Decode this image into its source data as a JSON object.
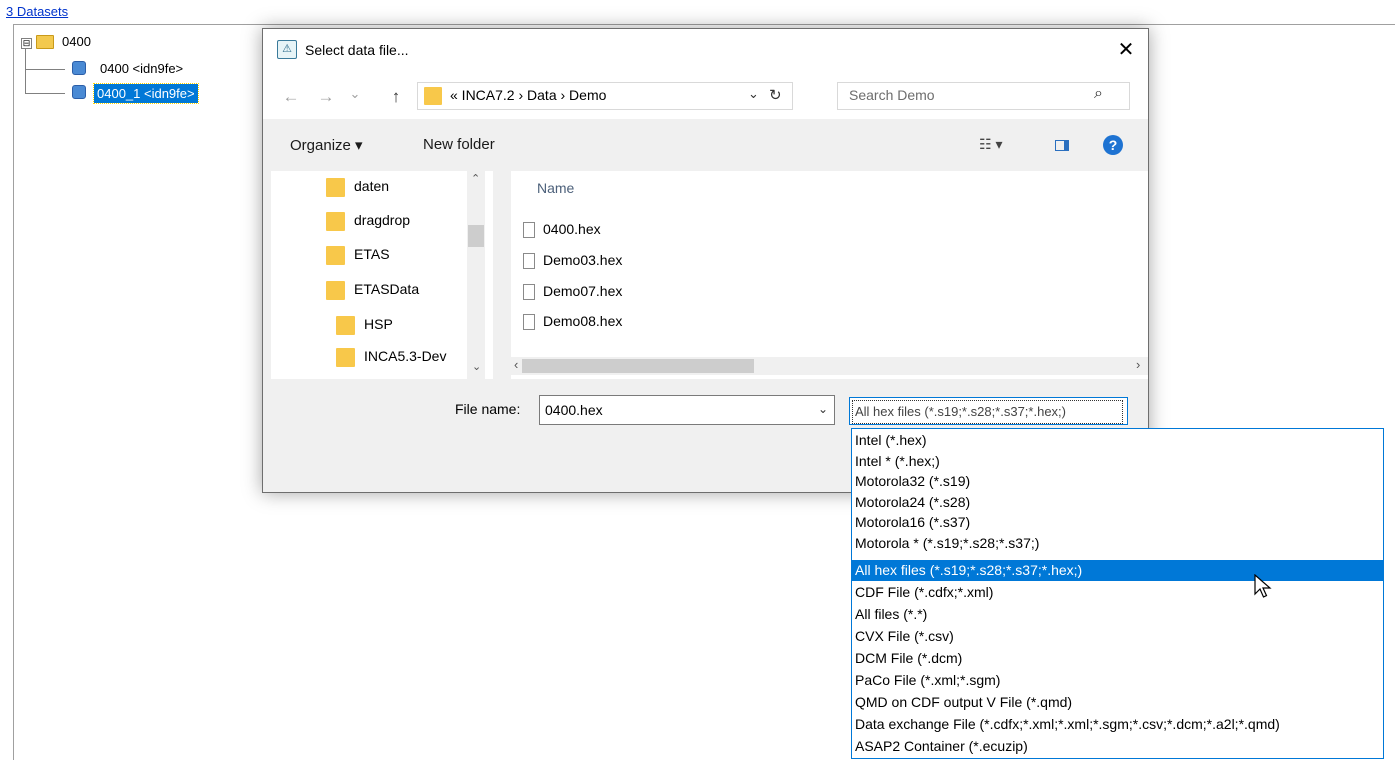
{
  "background": {
    "datasets_link": "3 Datasets",
    "tree": {
      "root": {
        "label": "0400"
      },
      "items": [
        {
          "label": "0400 <idn9fe>",
          "selected": false
        },
        {
          "label": "0400_1 <idn9fe>",
          "selected": true
        }
      ],
      "expander": "⊟"
    }
  },
  "dialog": {
    "title": "Select data file...",
    "close_glyph": "✕",
    "nav": {
      "back": "←",
      "forward": "→",
      "recent": "⌄",
      "up": "↑"
    },
    "address": {
      "path": "«  INCA7.2  ›  Data  ›  Demo"
    },
    "search": {
      "placeholder": "Search Demo"
    },
    "toolbar": {
      "organize_label": "Organize ▾",
      "new_folder_label": "New folder"
    },
    "nav_pane": {
      "items": [
        {
          "label": "daten"
        },
        {
          "label": "dragdrop"
        },
        {
          "label": "ETAS"
        },
        {
          "label": "ETASData"
        },
        {
          "label": "HSP"
        },
        {
          "label": "INCA5.3-Dev"
        }
      ]
    },
    "file_list": {
      "column_name": "Name",
      "files": [
        {
          "name": "0400.hex"
        },
        {
          "name": "Demo03.hex"
        },
        {
          "name": "Demo07.hex"
        },
        {
          "name": "Demo08.hex"
        }
      ]
    },
    "file_name": {
      "label": "File name:",
      "value": "0400.hex"
    },
    "file_type": {
      "value": "All hex files (*.s19;*.s28;*.s37;*.hex;)"
    }
  },
  "dropdown": {
    "options": [
      {
        "label": "Intel (*.hex)"
      },
      {
        "label": "Intel * (*.hex;)"
      },
      {
        "label": "Motorola32 (*.s19)"
      },
      {
        "label": "Motorola24 (*.s28)"
      },
      {
        "label": "Motorola16 (*.s37)"
      },
      {
        "label": "Motorola * (*.s19;*.s28;*.s37;)"
      },
      {
        "label": "All hex files (*.s19;*.s28;*.s37;*.hex;)",
        "selected": true
      },
      {
        "label": "CDF File  (*.cdfx;*.xml)"
      },
      {
        "label": "All files  (*.*)"
      },
      {
        "label": "CVX File  (*.csv)"
      },
      {
        "label": "DCM File  (*.dcm)"
      },
      {
        "label": "PaCo File  (*.xml;*.sgm)"
      },
      {
        "label": "QMD on CDF output V File  (*.qmd)"
      },
      {
        "label": "Data exchange File  (*.cdfx;*.xml;*.xml;*.sgm;*.csv;*.dcm;*.a2l;*.qmd)"
      },
      {
        "label": "ASAP2 Container (*.ecuzip)"
      }
    ]
  },
  "colors": {
    "selection": "#0078d7",
    "folder": "#f8c84a",
    "dialog_bg": "#f0f0f0"
  }
}
